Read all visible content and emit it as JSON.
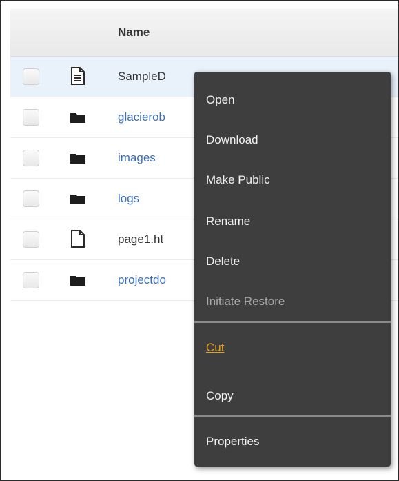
{
  "table": {
    "header": {
      "name_label": "Name"
    },
    "rows": [
      {
        "name": "SampleD",
        "type": "document",
        "icon": "document-icon"
      },
      {
        "name": "glacierob",
        "type": "folder",
        "icon": "folder-icon"
      },
      {
        "name": "images",
        "type": "folder",
        "icon": "folder-icon"
      },
      {
        "name": "logs",
        "type": "folder",
        "icon": "folder-icon"
      },
      {
        "name": "page1.ht",
        "type": "file",
        "icon": "file-icon"
      },
      {
        "name": "projectdo",
        "type": "folder",
        "icon": "folder-icon"
      }
    ]
  },
  "context_menu": {
    "items": [
      {
        "label": "Open",
        "state": "enabled"
      },
      {
        "label": "Download",
        "state": "enabled"
      },
      {
        "label": "Make Public",
        "state": "enabled"
      },
      {
        "label": "Rename",
        "state": "enabled"
      },
      {
        "label": "Delete",
        "state": "enabled"
      },
      {
        "label": "Initiate Restore",
        "state": "disabled"
      },
      {
        "label": "Cut",
        "state": "highlighted"
      },
      {
        "label": "Copy",
        "state": "enabled"
      },
      {
        "label": "Properties",
        "state": "enabled"
      }
    ]
  },
  "colors": {
    "link": "#3b6fbf",
    "menu_background": "#3e3e3e",
    "menu_highlight": "#e4a11b",
    "selected_row": "#e9f1fb"
  }
}
